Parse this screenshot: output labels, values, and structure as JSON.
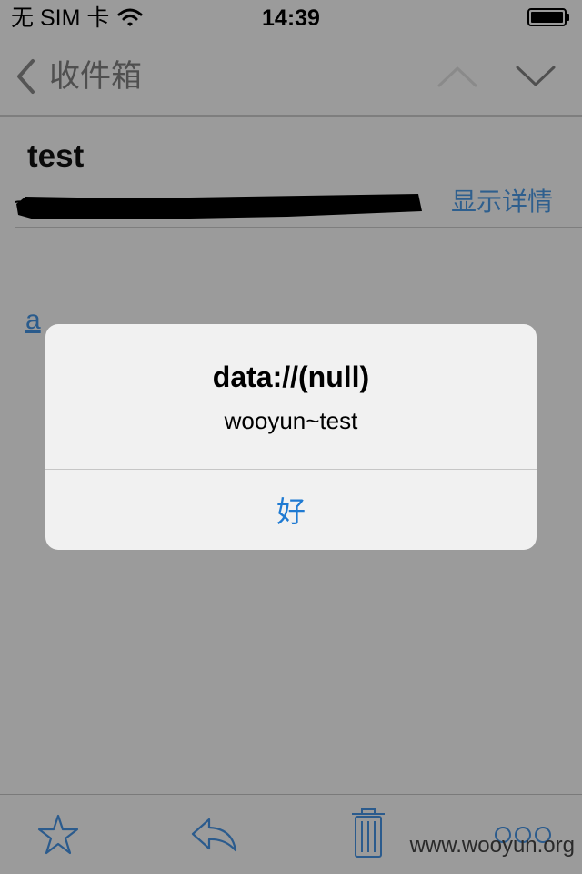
{
  "status_bar": {
    "carrier": "无 SIM 卡",
    "time": "14:39",
    "icons": [
      "wifi-icon",
      "battery-icon"
    ]
  },
  "nav": {
    "back_label": "收件箱",
    "icons": [
      "chevron-left-icon",
      "chevron-up-icon",
      "chevron-down-icon"
    ]
  },
  "message": {
    "subject": "test",
    "details_label": "显示详情",
    "body_link": "a"
  },
  "alert": {
    "title": "data://(null)",
    "message": "wooyun~test",
    "button_label": "好"
  },
  "toolbar": {
    "icons": [
      "star-icon",
      "reply-icon",
      "trash-icon",
      "more-icon"
    ]
  },
  "watermark": "www.wooyun.org",
  "colors": {
    "background_overlay": "#9b9b9b",
    "alert_background": "#f1f1f1",
    "accent": "#1f7ad2",
    "link": "#2e5f8e"
  }
}
